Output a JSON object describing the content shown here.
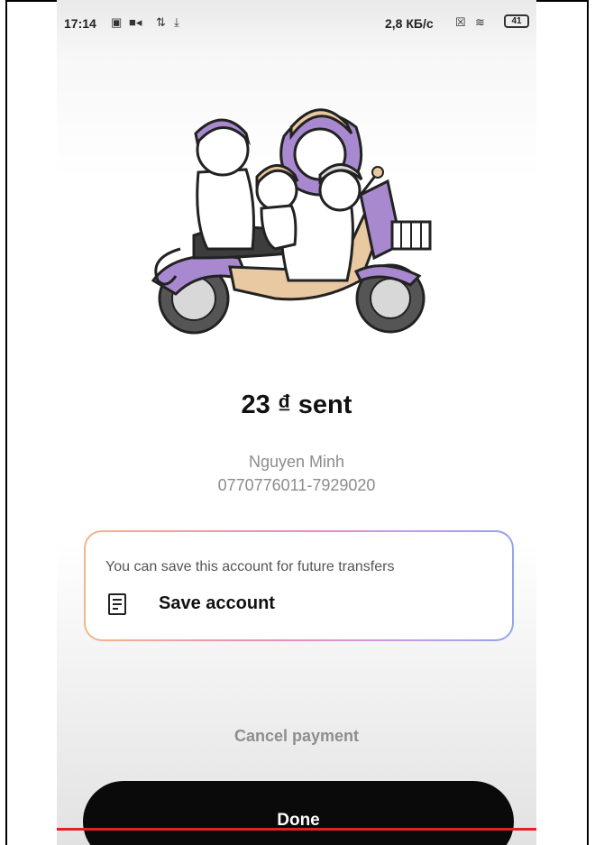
{
  "status_bar": {
    "time": "17:14",
    "network_speed": "2,8 КБ/с",
    "battery_level": "41",
    "icons": [
      "image-icon",
      "video-icon",
      "arrows-icon",
      "download-icon",
      "sim-icon",
      "wifi-icon",
      "battery-icon"
    ]
  },
  "confirmation": {
    "amount_text": "23 ₫ sent",
    "recipient_name": "Nguyen Minh",
    "recipient_account": "0770776011-7929020"
  },
  "save_card": {
    "hint": "You can save this account for future transfers",
    "action_label": "Save account",
    "icon": "document-icon"
  },
  "actions": {
    "cancel_label": "Cancel payment",
    "done_label": "Done"
  },
  "colors": {
    "done_button": "#0a0a0a",
    "gradient_border": [
      "#f0b68a",
      "#ef8bb9",
      "#c79be8",
      "#8fa6ee"
    ],
    "illustration_accent": "#a889d0",
    "scooter_body": "#e8c9a1",
    "bottom_line": "#e32222"
  }
}
